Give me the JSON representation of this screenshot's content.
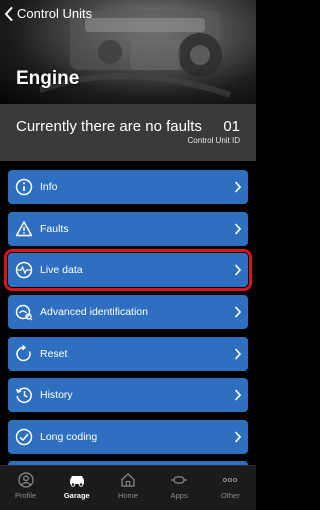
{
  "nav": {
    "back_label": "Control Units"
  },
  "header": {
    "title": "Engine"
  },
  "status": {
    "text": "Currently there are no faults",
    "unit_id": "01",
    "unit_id_label": "Control Unit ID"
  },
  "menu": {
    "items": [
      {
        "label": "Info",
        "icon": "info-icon"
      },
      {
        "label": "Faults",
        "icon": "warning-icon"
      },
      {
        "label": "Live data",
        "icon": "pulse-icon",
        "highlighted": true
      },
      {
        "label": "Advanced identification",
        "icon": "identification-icon"
      },
      {
        "label": "Reset",
        "icon": "reset-icon"
      },
      {
        "label": "History",
        "icon": "history-icon"
      },
      {
        "label": "Long coding",
        "icon": "check-circle-icon"
      }
    ]
  },
  "tabbar": {
    "tabs": [
      {
        "label": "Profile",
        "icon": "profile-icon"
      },
      {
        "label": "Garage",
        "icon": "garage-icon",
        "active": true
      },
      {
        "label": "Home",
        "icon": "home-icon"
      },
      {
        "label": "Apps",
        "icon": "apps-icon"
      },
      {
        "label": "Other",
        "icon": "more-icon"
      }
    ]
  },
  "colors": {
    "accent": "#2f6fc0",
    "highlight": "#d6141c",
    "background": "#000000",
    "status_bar": "#3a3a3a"
  }
}
